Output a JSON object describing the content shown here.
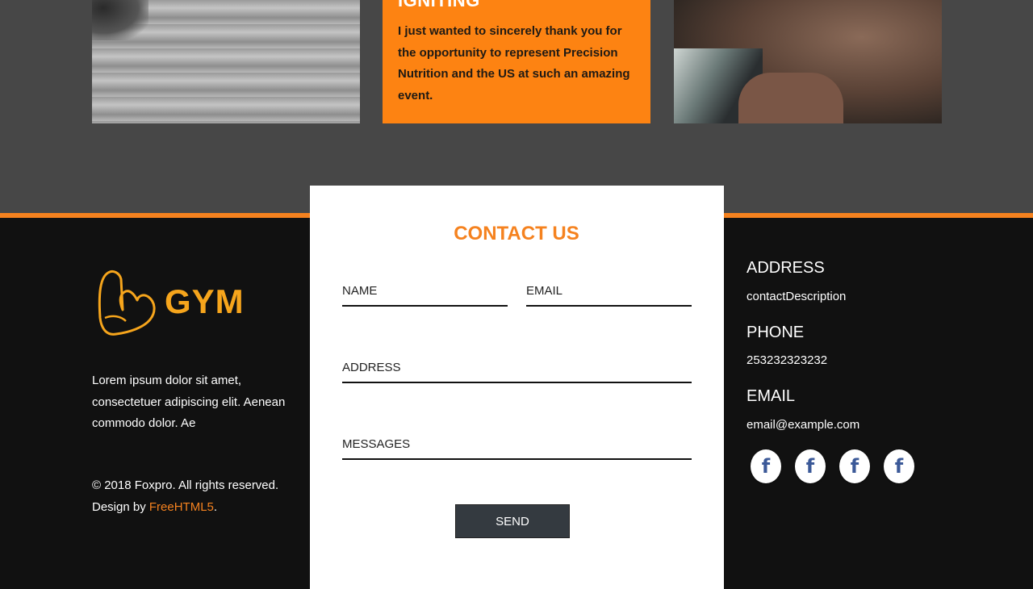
{
  "top": {
    "card": {
      "heading": "IGNITING",
      "text": "I just wanted to sincerely thank you for the opportunity to represent Precision Nutrition and the US at such an amazing event."
    }
  },
  "contact": {
    "title": "CONTACT US",
    "fields": {
      "name": "NAME",
      "email": "EMAIL",
      "address": "ADDRESS",
      "messages": "MESSAGES"
    },
    "send_label": "SEND"
  },
  "footer": {
    "logo_text": "GYM",
    "about": "Lorem ipsum dolor sit amet, consectetuer adipiscing elit. Aenean commodo dolor. Ae",
    "copyright": "© 2018 Foxpro. All rights reserved.",
    "design_prefix": "Design by ",
    "design_link": "FreeHTML5",
    "design_suffix": "."
  },
  "info": {
    "address_heading": "ADDRESS",
    "address_value": "contactDescription",
    "phone_heading": "PHONE",
    "phone_value": "253232323232",
    "email_heading": "EMAIL",
    "email_value": "email@example.com"
  },
  "social": {
    "icon": "facebook-icon",
    "glyph": "f"
  },
  "colors": {
    "accent": "#f5821f",
    "button": "#343a40",
    "facebook": "#3b5998"
  }
}
